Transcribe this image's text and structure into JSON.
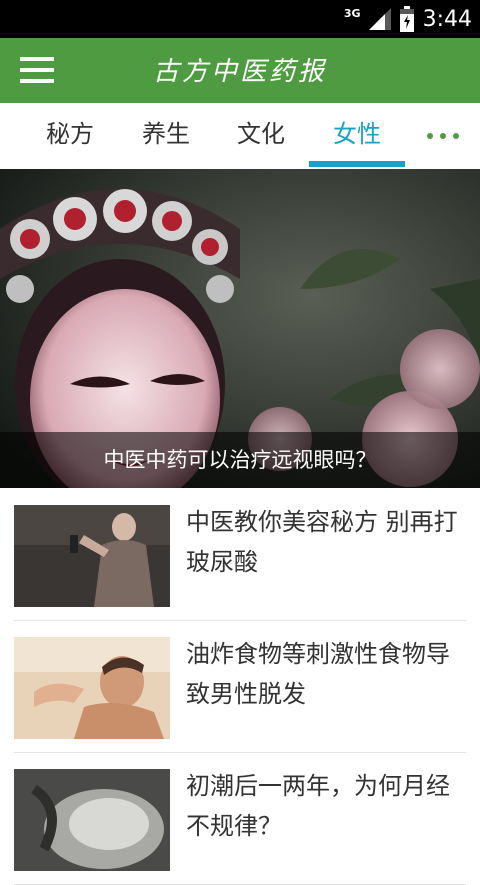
{
  "status_bar": {
    "network": "3G",
    "time": "3:44",
    "icons": [
      "signal-icon",
      "battery-icon"
    ]
  },
  "app_bar": {
    "title": "古方中医药报",
    "menu_icon": "hamburger-menu-icon"
  },
  "tabs": [
    {
      "label": "秘方",
      "active": false
    },
    {
      "label": "养生",
      "active": false
    },
    {
      "label": "文化",
      "active": false
    },
    {
      "label": "女性",
      "active": true
    }
  ],
  "more_icon": "more-dots-icon",
  "colors": {
    "app_bar": "#4f9b41",
    "accent": "#1ba0c8",
    "text": "#333333"
  },
  "banner": {
    "caption": "中医中药可以治疗远视眼吗？"
  },
  "articles": [
    {
      "title": "中医教你美容秘方 别再打玻尿酸"
    },
    {
      "title": "油炸食物等刺激性食物导致男性脱发"
    },
    {
      "title": "初潮后一两年，为何月经不规律？"
    }
  ]
}
